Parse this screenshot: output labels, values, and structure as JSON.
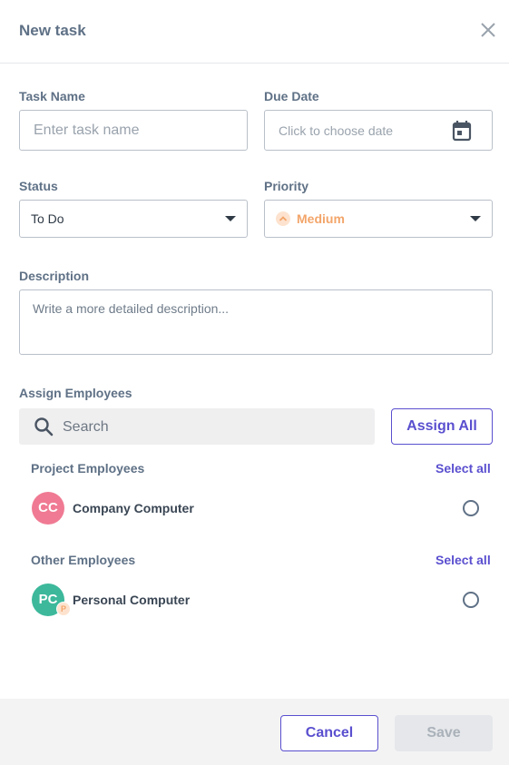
{
  "header": {
    "title": "New task"
  },
  "form": {
    "task_name_label": "Task Name",
    "task_name_placeholder": "Enter task name",
    "due_date_label": "Due Date",
    "due_date_placeholder": "Click to choose date",
    "status_label": "Status",
    "status_value": "To Do",
    "priority_label": "Priority",
    "priority_value": "Medium",
    "description_label": "Description",
    "description_placeholder": "Write a more detailed description..."
  },
  "assign": {
    "label": "Assign Employees",
    "search_placeholder": "Search",
    "assign_all_label": "Assign All",
    "project_section": {
      "title": "Project Employees",
      "select_all": "Select all",
      "employees": [
        {
          "initials": "CC",
          "name": "Company Computer",
          "avatar_color": "#f07a93"
        }
      ]
    },
    "other_section": {
      "title": "Other Employees",
      "select_all": "Select all",
      "employees": [
        {
          "initials": "PC",
          "name": "Personal Computer",
          "avatar_color": "#3db89b",
          "badge": "P"
        }
      ]
    }
  },
  "footer": {
    "cancel_label": "Cancel",
    "save_label": "Save"
  },
  "colors": {
    "accent": "#5a4fcf",
    "priority_medium": "#f3a56a"
  }
}
